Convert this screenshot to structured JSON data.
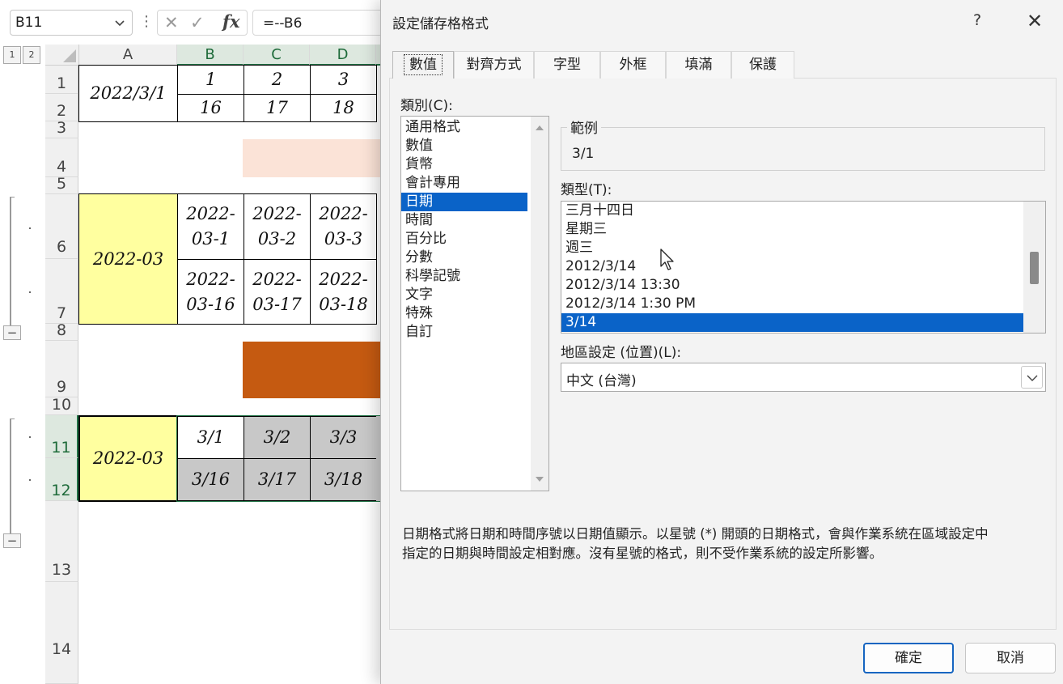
{
  "formula_bar": {
    "name_box": "B11",
    "cancel_glyph": "✕",
    "enter_glyph": "✓",
    "fx_label": "fx",
    "formula": "=--B6"
  },
  "outline": {
    "levels": [
      "1",
      "2"
    ],
    "collapse_glyph": "−"
  },
  "columns": [
    "A",
    "B",
    "C",
    "D"
  ],
  "rows": [
    "1",
    "2",
    "3",
    "4",
    "5",
    "6",
    "7",
    "8",
    "9",
    "10",
    "11",
    "12",
    "13",
    "14"
  ],
  "sheet": {
    "a1": "2022/3/1",
    "b1": "1",
    "c1": "2",
    "d1": "3",
    "b2": "16",
    "c2": "17",
    "d2": "18",
    "a6": "2022-03",
    "b6_l1": "2022-",
    "b6_l2": "03-1",
    "c6_l1": "2022-",
    "c6_l2": "03-2",
    "d6_l1": "2022-",
    "d6_l2": "03-3",
    "b7_l1": "2022-",
    "b7_l2": "03-16",
    "c7_l1": "2022-",
    "c7_l2": "03-17",
    "d7_l1": "2022-",
    "d7_l2": "03-18",
    "a11": "2022-03",
    "b11": "3/1",
    "c11": "3/2",
    "d11": "3/3",
    "b12": "3/16",
    "c12": "3/17",
    "d12": "3/18"
  },
  "colors": {
    "peach": "#fbe3d7",
    "orange": "#c55a11",
    "yellow": "#ffff9f",
    "gray": "#c8c8c8",
    "selection_blue": "#0a63c8",
    "excel_green": "#217346"
  },
  "dialog": {
    "title": "設定儲存格格式",
    "help": "?",
    "close": "✕",
    "tabs": [
      "數值",
      "對齊方式",
      "字型",
      "外框",
      "填滿",
      "保護"
    ],
    "category_label": "類別(C):",
    "categories": [
      "通用格式",
      "數值",
      "貨幣",
      "會計專用",
      "日期",
      "時間",
      "百分比",
      "分數",
      "科學記號",
      "文字",
      "特殊",
      "自訂"
    ],
    "selected_category": "日期",
    "sample_label": "範例",
    "sample_value": "3/1",
    "type_label": "類型(T):",
    "types": [
      "三月十四日",
      "星期三",
      "週三",
      "2012/3/14",
      "2012/3/14 13:30",
      "2012/3/14 1:30 PM",
      "3/14"
    ],
    "selected_type": "3/14",
    "locale_label": "地區設定 (位置)(L):",
    "locale_value": "中文 (台灣)",
    "description_line1": "日期格式將日期和時間序號以日期值顯示。以星號 (*) 開頭的日期格式，會與作業系統在區域設定中",
    "description_line2": "指定的日期與時間設定相對應。沒有星號的格式，則不受作業系統的設定所影響。",
    "ok": "確定",
    "cancel": "取消"
  }
}
